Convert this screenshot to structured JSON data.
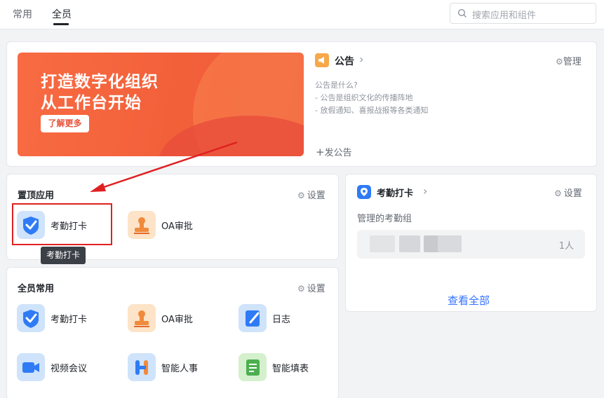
{
  "tabs": [
    {
      "label": "常用",
      "active": false
    },
    {
      "label": "全员",
      "active": true
    }
  ],
  "search": {
    "placeholder": "搜索应用和组件"
  },
  "banner": {
    "title_line1": "打造数字化组织",
    "title_line2": "从工作台开始",
    "button": "了解更多"
  },
  "notice": {
    "title": "公告",
    "manage": "管理",
    "lines": [
      "公告是什么?",
      "- 公告是组织文化的传播阵地",
      "- 放假通知、喜报战报等各类通知"
    ],
    "post": "发公告"
  },
  "pinned": {
    "title": "置顶应用",
    "settings": "设置",
    "apps": [
      {
        "label": "考勤打卡",
        "icon": "attendance-check-icon"
      },
      {
        "label": "OA审批",
        "icon": "stamp-icon"
      }
    ],
    "tooltip": "考勤打卡"
  },
  "common": {
    "title": "全员常用",
    "settings": "设置",
    "apps": [
      {
        "label": "考勤打卡",
        "icon": "attendance-check-icon"
      },
      {
        "label": "OA审批",
        "icon": "stamp-icon"
      },
      {
        "label": "日志",
        "icon": "log-icon"
      },
      {
        "label": "视频会议",
        "icon": "video-camera-icon"
      },
      {
        "label": "智能人事",
        "icon": "hr-icon"
      },
      {
        "label": "智能填表",
        "icon": "form-icon"
      }
    ]
  },
  "attendance": {
    "title": "考勤打卡",
    "settings": "设置",
    "group_label": "管理的考勤组",
    "count": "1人",
    "view_all": "查看全部"
  },
  "colors": {
    "accent": "#3370ff",
    "banner": "#f2603a",
    "highlight": "#e02020"
  }
}
